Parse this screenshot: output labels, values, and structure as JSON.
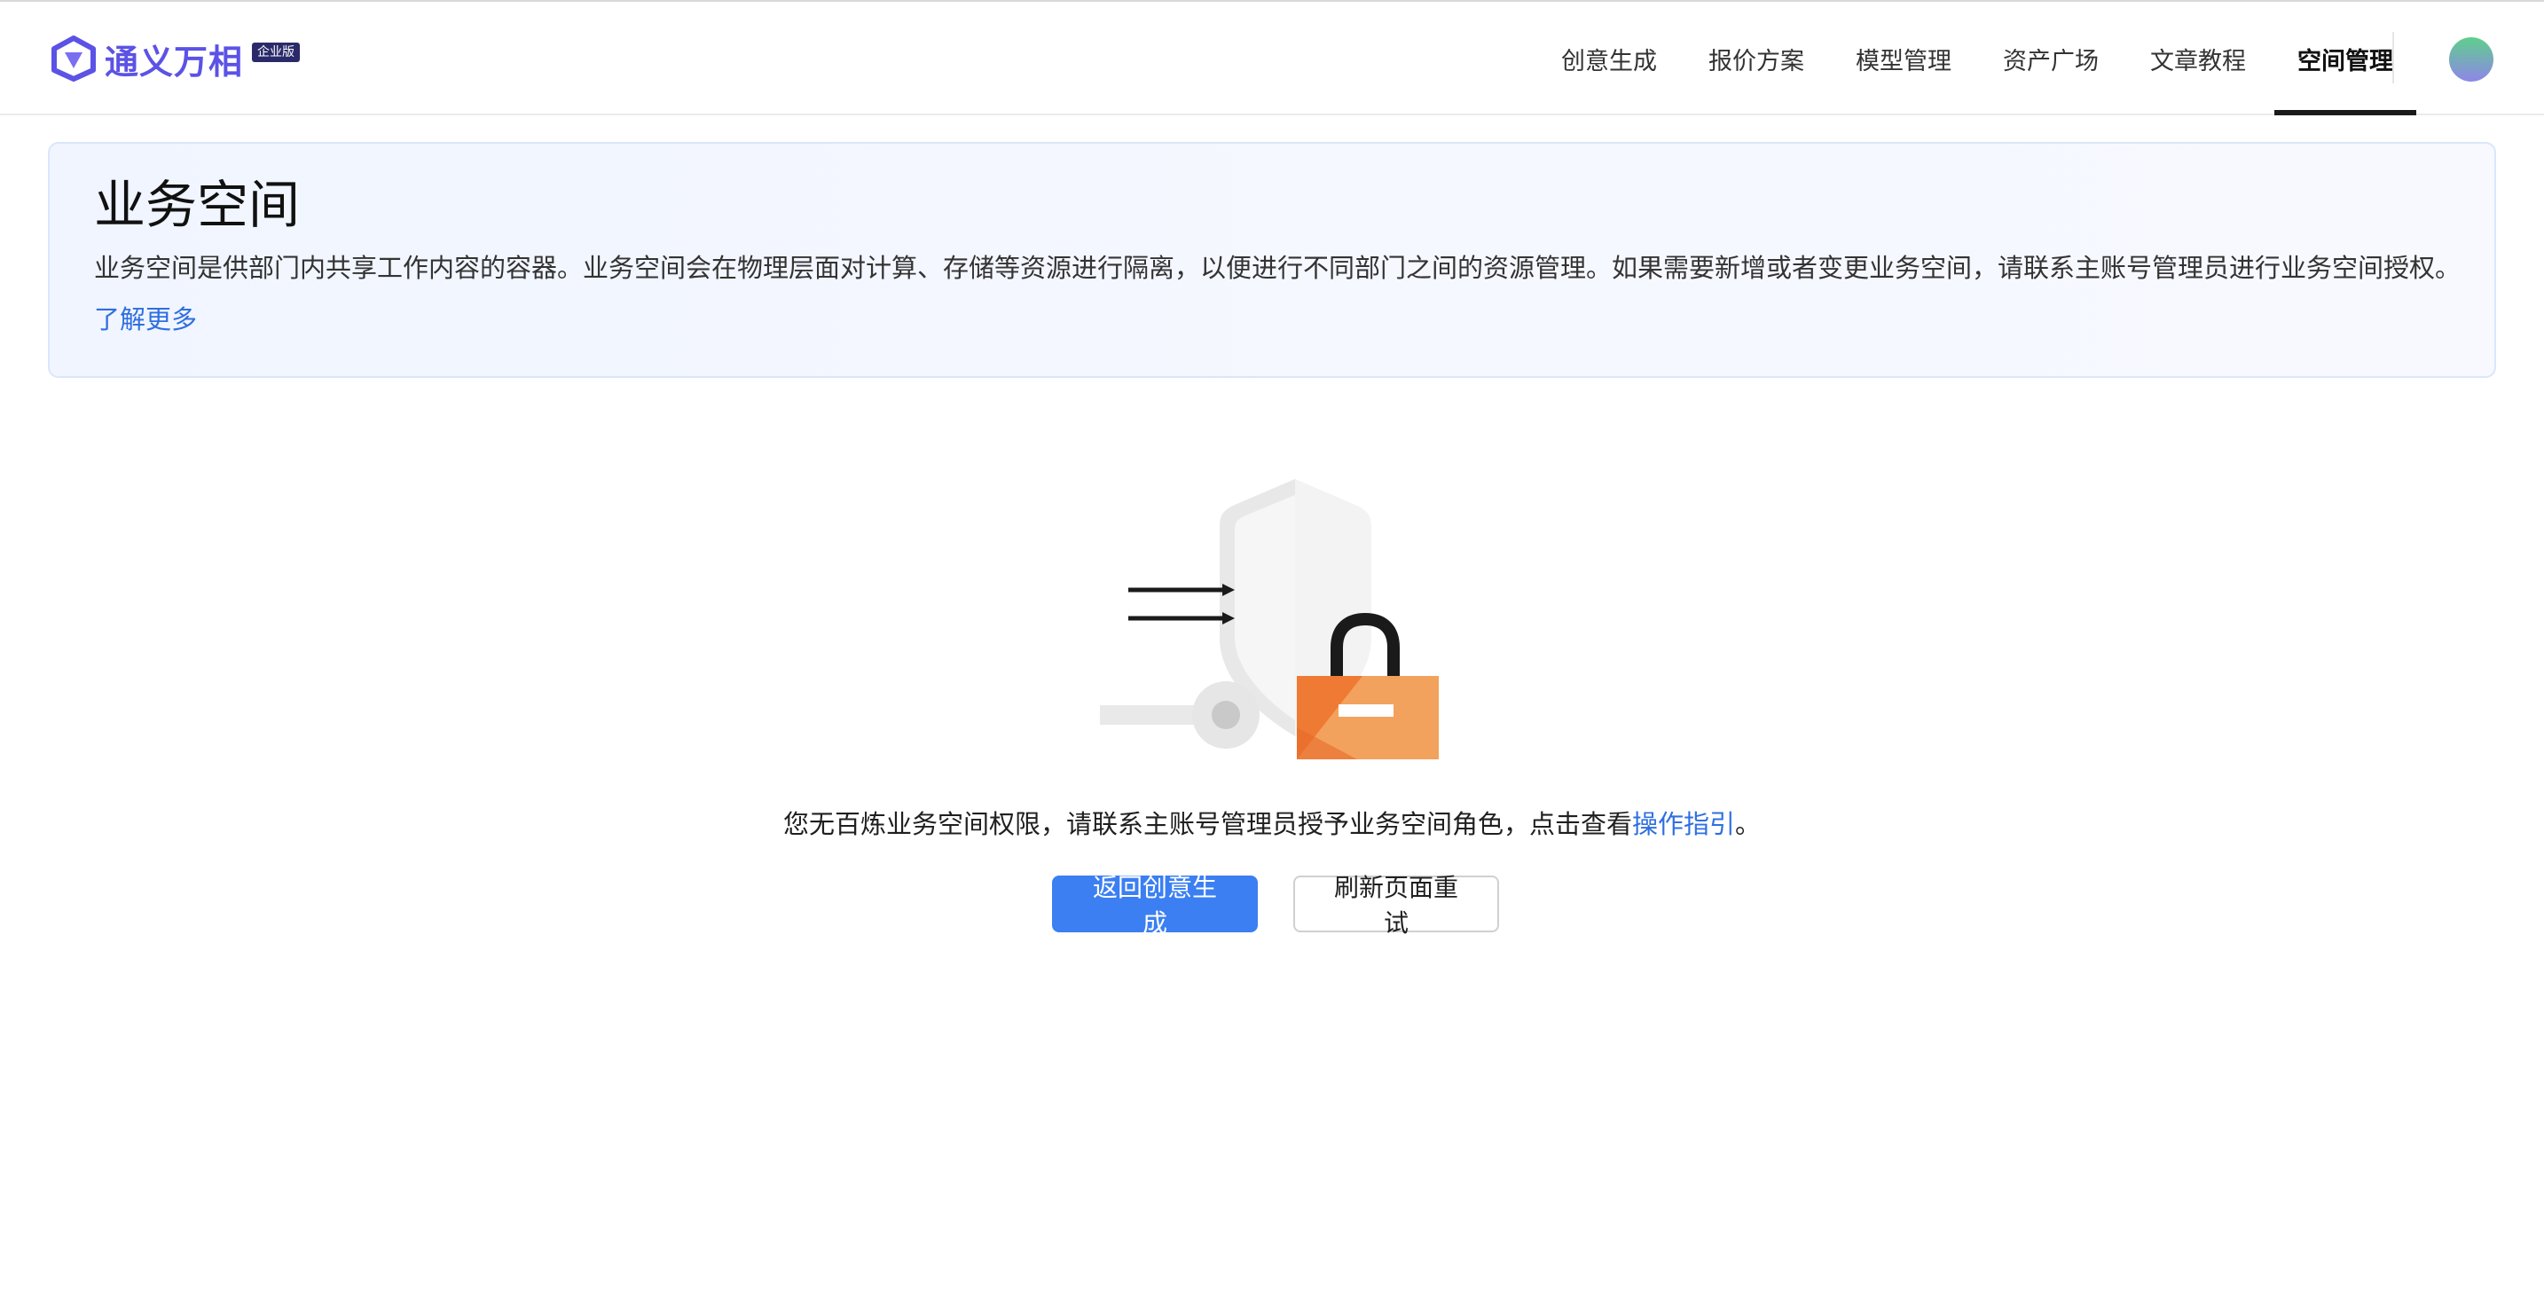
{
  "header": {
    "logo_text": "通义万相",
    "logo_badge": "企业版",
    "nav": [
      {
        "label": "创意生成",
        "active": false
      },
      {
        "label": "报价方案",
        "active": false
      },
      {
        "label": "模型管理",
        "active": false
      },
      {
        "label": "资产广场",
        "active": false
      },
      {
        "label": "文章教程",
        "active": false
      },
      {
        "label": "空间管理",
        "active": true
      }
    ],
    "avatar_icon": "avatar"
  },
  "banner": {
    "title": "业务空间",
    "description": "业务空间是供部门内共享工作内容的容器。业务空间会在物理层面对计算、存储等资源进行隔离，以便进行不同部门之间的资源管理。如果需要新增或者变更业务空间，请联系主账号管理员进行业务空间授权。",
    "link": "了解更多"
  },
  "empty_state": {
    "illustration": "shield-lock-illustration",
    "message_prefix": "您无百炼业务空间权限，请联系主账号管理员授予业务空间角色，点击查看",
    "message_link": "操作指引",
    "message_suffix": "。",
    "primary_button": "返回创意生成",
    "secondary_button": "刷新页面重试"
  },
  "colors": {
    "brand": "#5b52e6",
    "link": "#2f6fe0",
    "primary_button": "#3b7ff2",
    "lock_orange": "#f2a25c"
  }
}
